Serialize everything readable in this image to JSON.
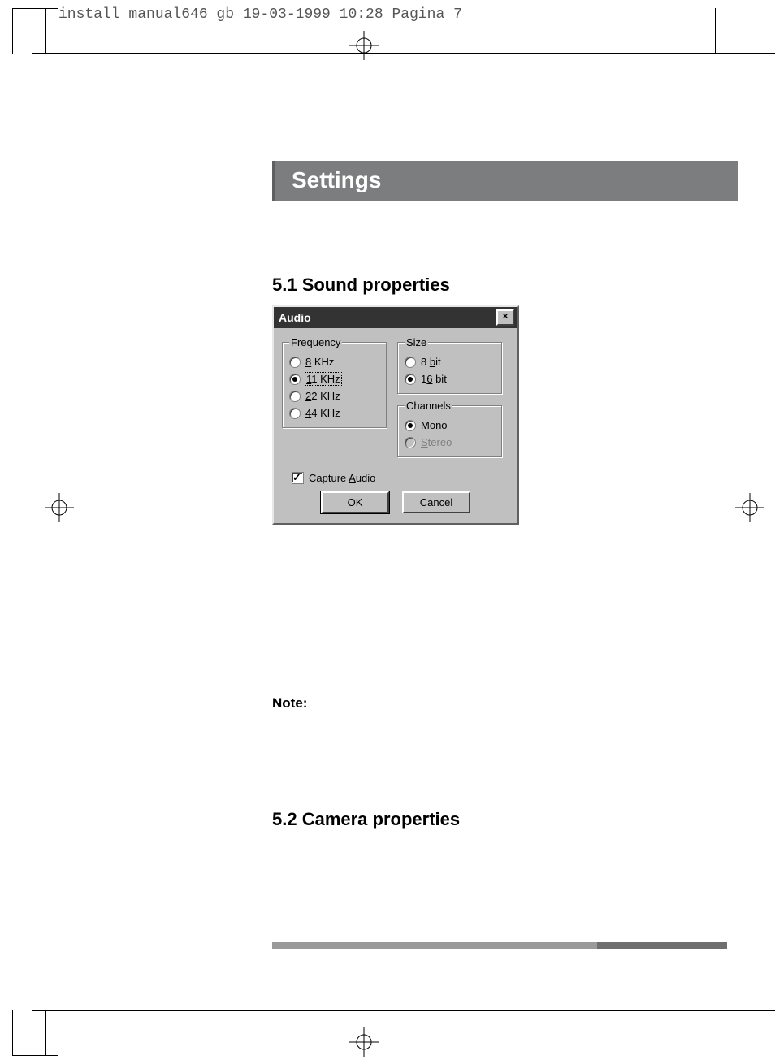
{
  "header": {
    "imprint": "install_manual646_gb  19-03-1999 10:28  Pagina 7"
  },
  "banner": {
    "title": "Settings"
  },
  "sections": {
    "s51": "5.1 Sound properties",
    "note_label": "Note:",
    "s52": "5.2 Camera properties"
  },
  "dialog": {
    "title": "Audio",
    "close_glyph": "×",
    "frequency": {
      "legend": "Frequency",
      "selected": "11",
      "opts": {
        "k8": {
          "pre": "",
          "u": "8",
          "post": " KHz"
        },
        "k11": {
          "pre": "",
          "u": "1",
          "post": "1 KHz"
        },
        "k22": {
          "pre": "",
          "u": "2",
          "post": "2 KHz"
        },
        "k44": {
          "pre": "",
          "u": "4",
          "post": "4 KHz"
        }
      }
    },
    "size": {
      "legend": "Size",
      "selected": "16",
      "opts": {
        "b8": {
          "pre": "8 ",
          "u": "b",
          "post": "it"
        },
        "b16": {
          "pre": "1",
          "u": "6",
          "post": " bit"
        }
      }
    },
    "channels": {
      "legend": "Channels",
      "selected": "mono",
      "stereo_enabled": false,
      "opts": {
        "mono": {
          "pre": "",
          "u": "M",
          "post": "ono"
        },
        "stereo": {
          "pre": "",
          "u": "S",
          "post": "tereo"
        }
      }
    },
    "capture": {
      "checked": true,
      "pre": "Capture ",
      "u": "A",
      "post": "udio"
    },
    "buttons": {
      "ok": "OK",
      "cancel": "Cancel"
    }
  }
}
